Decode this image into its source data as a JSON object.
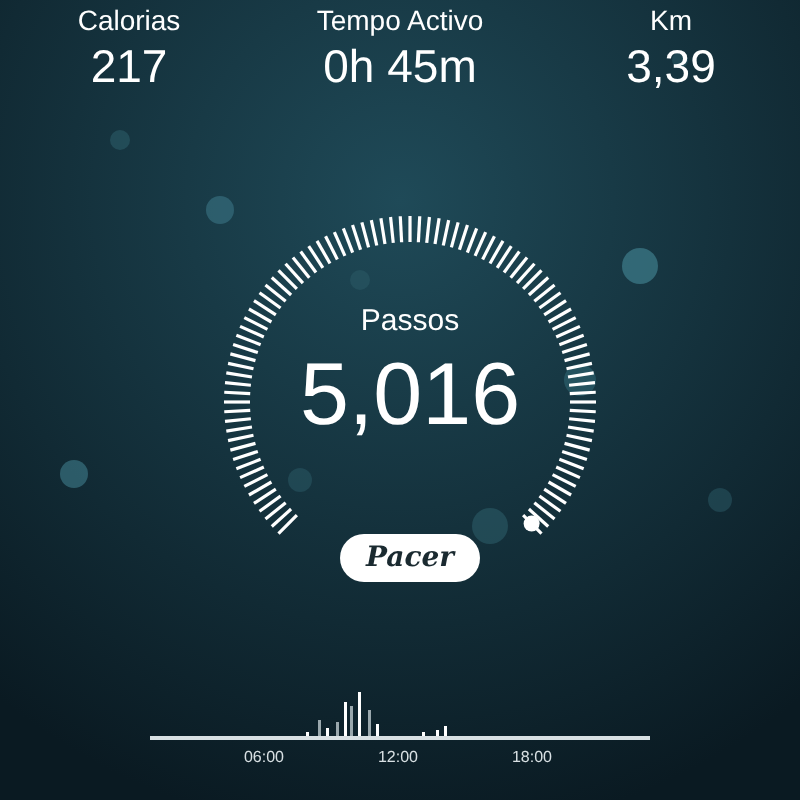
{
  "stats": [
    {
      "label": "Calorias",
      "value": "217"
    },
    {
      "label": "Tempo Activo",
      "value": "0h 45m"
    },
    {
      "label": "Km",
      "value": "3,39"
    }
  ],
  "gauge": {
    "label": "Passos",
    "value": "5,016"
  },
  "logo_button": {
    "label": "Pacer"
  },
  "activity": {
    "axis_labels": [
      "06:00",
      "12:00",
      "18:00"
    ]
  }
}
